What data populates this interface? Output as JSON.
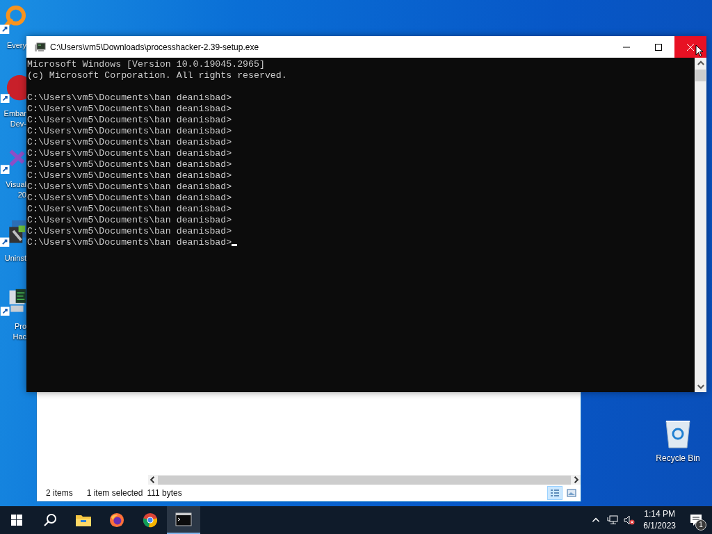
{
  "desktop_icons": [
    {
      "kind": "magnifier",
      "label_lines": [
        "Every"
      ]
    },
    {
      "kind": "dev-cpp",
      "label_lines": [
        "Embar",
        "Dev-"
      ]
    },
    {
      "kind": "visual-studio",
      "label_lines": [
        "Visual",
        "20"
      ]
    },
    {
      "kind": "uninstaller",
      "label_lines": [
        "Uninst"
      ]
    },
    {
      "kind": "process-hacker",
      "label_lines": [
        "Pro",
        "Hac"
      ]
    }
  ],
  "recycle_bin": {
    "label": "Recycle Bin"
  },
  "explorer_window": {
    "status_items": [
      "2 items",
      "1 item selected",
      "111 bytes"
    ],
    "view_buttons": [
      {
        "kind": "details",
        "selected": true
      },
      {
        "kind": "thumbnails",
        "selected": false
      }
    ]
  },
  "console_window": {
    "title": "C:\\Users\\vm5\\Downloads\\processhacker-2.39-setup.exe",
    "close_hovered": true,
    "header_lines": [
      "Microsoft Windows [Version 10.0.19045.2965]",
      "(c) Microsoft Corporation. All rights reserved."
    ],
    "prompt_lines": [
      "C:\\Users\\vm5\\Documents\\ban deanisbad>",
      "C:\\Users\\vm5\\Documents\\ban deanisbad>",
      "C:\\Users\\vm5\\Documents\\ban deanisbad>",
      "C:\\Users\\vm5\\Documents\\ban deanisbad>",
      "C:\\Users\\vm5\\Documents\\ban deanisbad>",
      "C:\\Users\\vm5\\Documents\\ban deanisbad>",
      "C:\\Users\\vm5\\Documents\\ban deanisbad>",
      "C:\\Users\\vm5\\Documents\\ban deanisbad>",
      "C:\\Users\\vm5\\Documents\\ban deanisbad>",
      "C:\\Users\\vm5\\Documents\\ban deanisbad>",
      "C:\\Users\\vm5\\Documents\\ban deanisbad>",
      "C:\\Users\\vm5\\Documents\\ban deanisbad>",
      "C:\\Users\\vm5\\Documents\\ban deanisbad>",
      "C:\\Users\\vm5\\Documents\\ban deanisbad>"
    ],
    "cursor_visible": true
  },
  "taskbar": {
    "apps": [
      {
        "kind": "file-explorer",
        "active": false
      },
      {
        "kind": "firefox",
        "active": false
      },
      {
        "kind": "chrome",
        "active": false
      },
      {
        "kind": "terminal",
        "active": true
      }
    ],
    "clock": {
      "time": "1:14 PM",
      "date": "6/1/2023"
    },
    "notification_count": "1"
  }
}
